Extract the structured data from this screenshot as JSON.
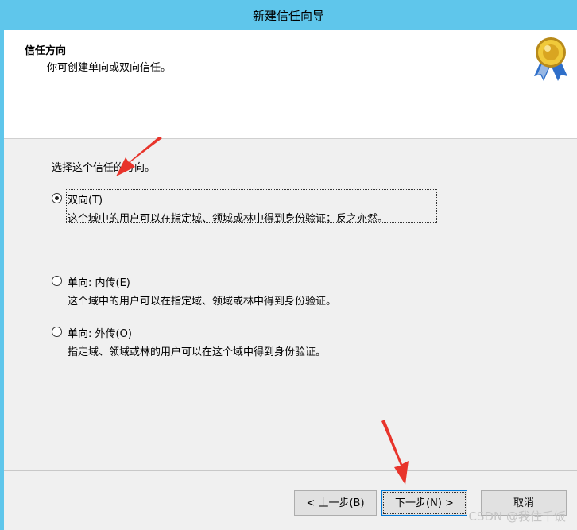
{
  "window": {
    "title": "新建信任向导"
  },
  "header": {
    "title": "信任方向",
    "subtitle": "你可创建单向或双向信任。"
  },
  "prompt": "选择这个信任的方向。",
  "options": [
    {
      "label": "双向(T)",
      "desc": "这个域中的用户可以在指定域、领域或林中得到身份验证；反之亦然。",
      "selected": true
    },
    {
      "label": "单向: 内传(E)",
      "desc": "这个域中的用户可以在指定域、领域或林中得到身份验证。",
      "selected": false
    },
    {
      "label": "单向: 外传(O)",
      "desc": "指定域、领域或林的用户可以在这个域中得到身份验证。",
      "selected": false
    }
  ],
  "buttons": {
    "back": "< 上一步(B)",
    "next": "下一步(N) >",
    "cancel": "取消"
  },
  "watermark": "CSDN @我住千饭",
  "colors": {
    "titlebar": "#5fc6eb",
    "arrow": "#e8342b",
    "default_button_border": "#0078d7"
  }
}
